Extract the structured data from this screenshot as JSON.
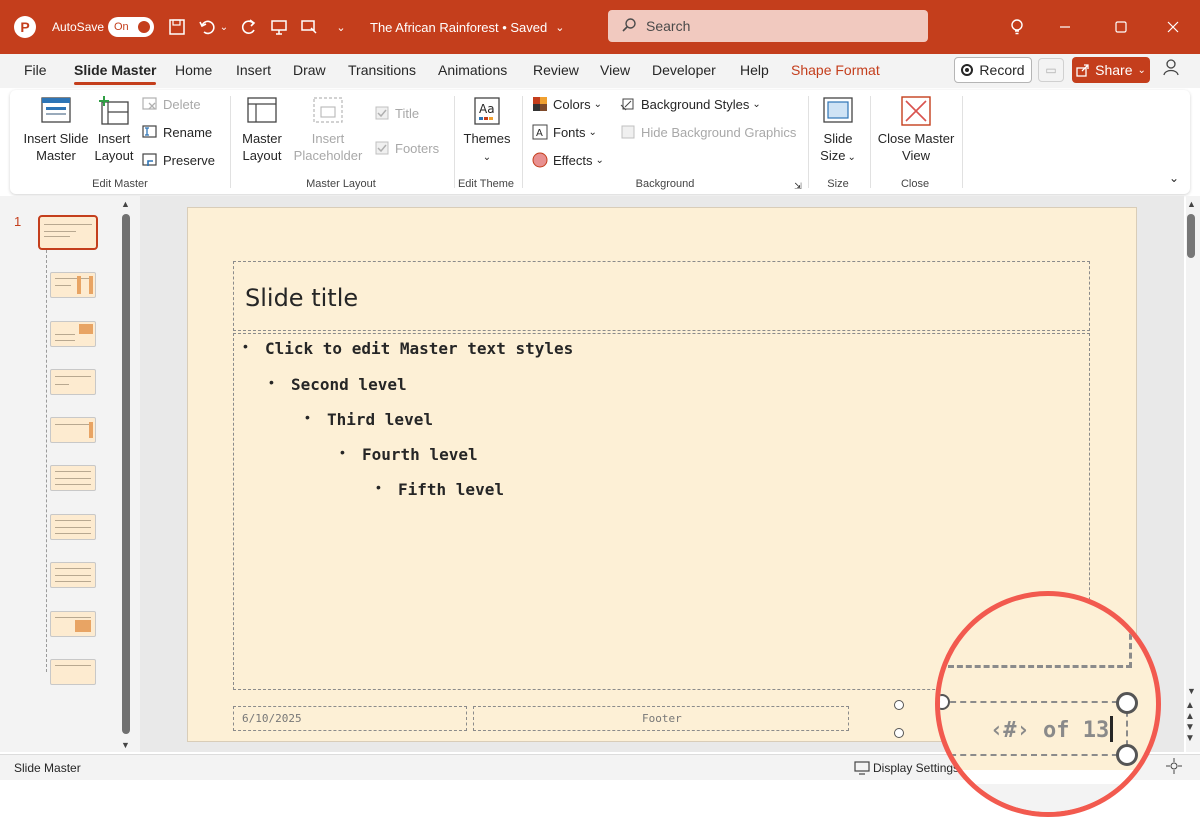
{
  "titlebar": {
    "autosave_label": "AutoSave",
    "autosave_state": "On",
    "doc_title": "The African Rainforest • Saved",
    "search_placeholder": "Search"
  },
  "tabs": [
    "File",
    "Slide Master",
    "Home",
    "Insert",
    "Draw",
    "Transitions",
    "Animations",
    "Review",
    "View",
    "Developer",
    "Help",
    "Shape Format"
  ],
  "active_tab": "Slide Master",
  "actions": {
    "record": "Record",
    "share": "Share"
  },
  "ribbon": {
    "edit_master": {
      "label": "Edit Master",
      "insert_slide_master": "Insert Slide Master",
      "insert_layout": "Insert Layout",
      "delete": "Delete",
      "rename": "Rename",
      "preserve": "Preserve"
    },
    "master_layout": {
      "label": "Master Layout",
      "master_layout_btn": "Master Layout",
      "insert_placeholder": "Insert Placeholder",
      "title": "Title",
      "footers": "Footers"
    },
    "edit_theme": {
      "label": "Edit Theme",
      "themes": "Themes"
    },
    "background": {
      "label": "Background",
      "colors": "Colors",
      "fonts": "Fonts",
      "effects": "Effects",
      "background_styles": "Background Styles",
      "hide_background_graphics": "Hide Background Graphics"
    },
    "size": {
      "label": "Size",
      "slide_size": "Slide Size"
    },
    "close": {
      "label": "Close",
      "close_master_view": "Close Master View"
    }
  },
  "thumbnails": {
    "selected_number": "1",
    "count": 10
  },
  "slide": {
    "title": "Slide title",
    "levels": [
      "Click to edit Master text styles",
      "Second level",
      "Third level",
      "Fourth level",
      "Fifth level"
    ],
    "date": "6/10/2025",
    "footer": "Footer",
    "page_number": "‹#› of 13"
  },
  "statusbar": {
    "mode": "Slide Master",
    "display_settings": "Display Settings"
  },
  "colors": {
    "accent": "#c43e1c",
    "slide_bg": "#fdf0d6",
    "magnifier_ring": "#f25a4f"
  }
}
